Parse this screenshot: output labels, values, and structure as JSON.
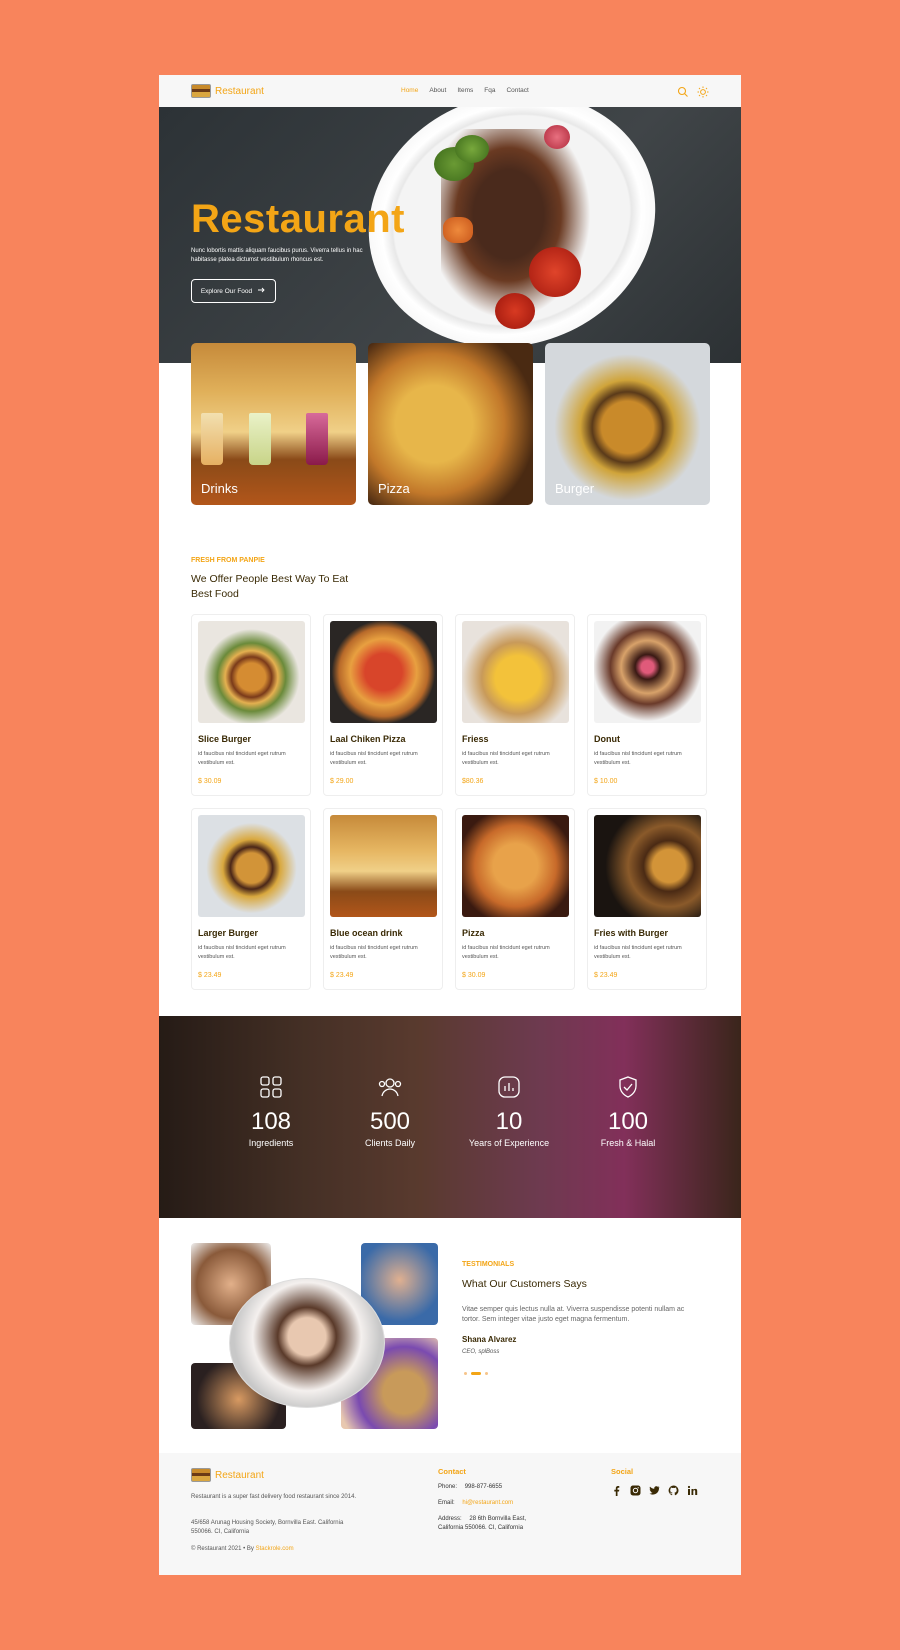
{
  "nav": {
    "brand": "Restaurant",
    "links": [
      "Home",
      "About",
      "Items",
      "Fqa",
      "Contact"
    ],
    "icons": [
      "search-icon",
      "sun-icon"
    ],
    "accent": "#F3A516"
  },
  "hero": {
    "title": "Restaurant",
    "text": "Nunc lobortis mattis aliquam faucibus purus. Viverra tellus in hac habitasse platea dictumst vestibulum rhoncus est.",
    "button": "Explore Our Food",
    "button_icon": "arrow-right-icon"
  },
  "categories": [
    "Drinks",
    "Pizza",
    "Burger"
  ],
  "menu_section": {
    "eyebrow": "FRESH FROM PANPIE",
    "title_line1": "We Offer People Best Way To Eat",
    "title_line2": "Best Food"
  },
  "products": [
    {
      "name": "Slice Burger",
      "desc": "id faucibus nisl tincidunt eget rutrum vestibulum est.",
      "price": "$ 30.09"
    },
    {
      "name": "Laal Chiken Pizza",
      "desc": "id faucibus nisl tincidunt eget rutrum vestibulum est.",
      "price": "$ 29.00"
    },
    {
      "name": "Friess",
      "desc": "id faucibus nisl tincidunt eget rutrum vestibulum est.",
      "price": "$80.36"
    },
    {
      "name": "Donut",
      "desc": "id faucibus nisl tincidunt eget rutrum vestibulum est.",
      "price": "$ 10.00"
    },
    {
      "name": "Larger Burger",
      "desc": "id faucibus nisl tincidunt eget rutrum vestibulum est.",
      "price": "$ 23.49"
    },
    {
      "name": "Blue ocean drink",
      "desc": "id faucibus nisl tincidunt eget rutrum vestibulum est.",
      "price": "$ 23.49"
    },
    {
      "name": "Pizza",
      "desc": "id faucibus nisl tincidunt eget rutrum vestibulum est.",
      "price": "$ 30.09"
    },
    {
      "name": "Fries with Burger",
      "desc": "id faucibus nisl tincidunt eget rutrum vestibulum est.",
      "price": "$ 23.49"
    }
  ],
  "stats": [
    {
      "icon": "grid-icon",
      "value": "108",
      "label": "Ingredients"
    },
    {
      "icon": "users-icon",
      "value": "500",
      "label": "Clients Daily"
    },
    {
      "icon": "chart-icon",
      "value": "10",
      "label": "Years of Experience"
    },
    {
      "icon": "shield-icon",
      "value": "100",
      "label": "Fresh & Halal"
    }
  ],
  "testimonial": {
    "eyebrow": "TESTIMONIALS",
    "title": "What Our Customers Says",
    "quote": "Vitae semper quis lectus nulla at. Viverra suspendisse potenti nullam ac tortor. Sem integer vitae justo eget magna fermentum.",
    "name": "Shana Alvarez",
    "role": "CEO, splBoss"
  },
  "footer": {
    "brand": "Restaurant",
    "about": "Restaurant is a super fast delivery food restaurant since 2014.",
    "address": "45/658 Arunag Housing Society, Bornvilla East. California 550066. CI, California",
    "copyright": "© Restaurant 2021 • By",
    "credit": "Stackrole.com",
    "contact_heading": "Contact",
    "phone_label": "Phone:",
    "phone": "998-877-6655",
    "email_label": "Email:",
    "email": "hi@restaurant.com",
    "address_label": "Address:",
    "contact_address_1": "28 6th Bornvilla East,",
    "contact_address_2": "California 550066. CI, California",
    "social_heading": "Social",
    "social_icons": [
      "facebook-icon",
      "instagram-icon",
      "twitter-icon",
      "github-icon",
      "linkedin-icon"
    ]
  }
}
